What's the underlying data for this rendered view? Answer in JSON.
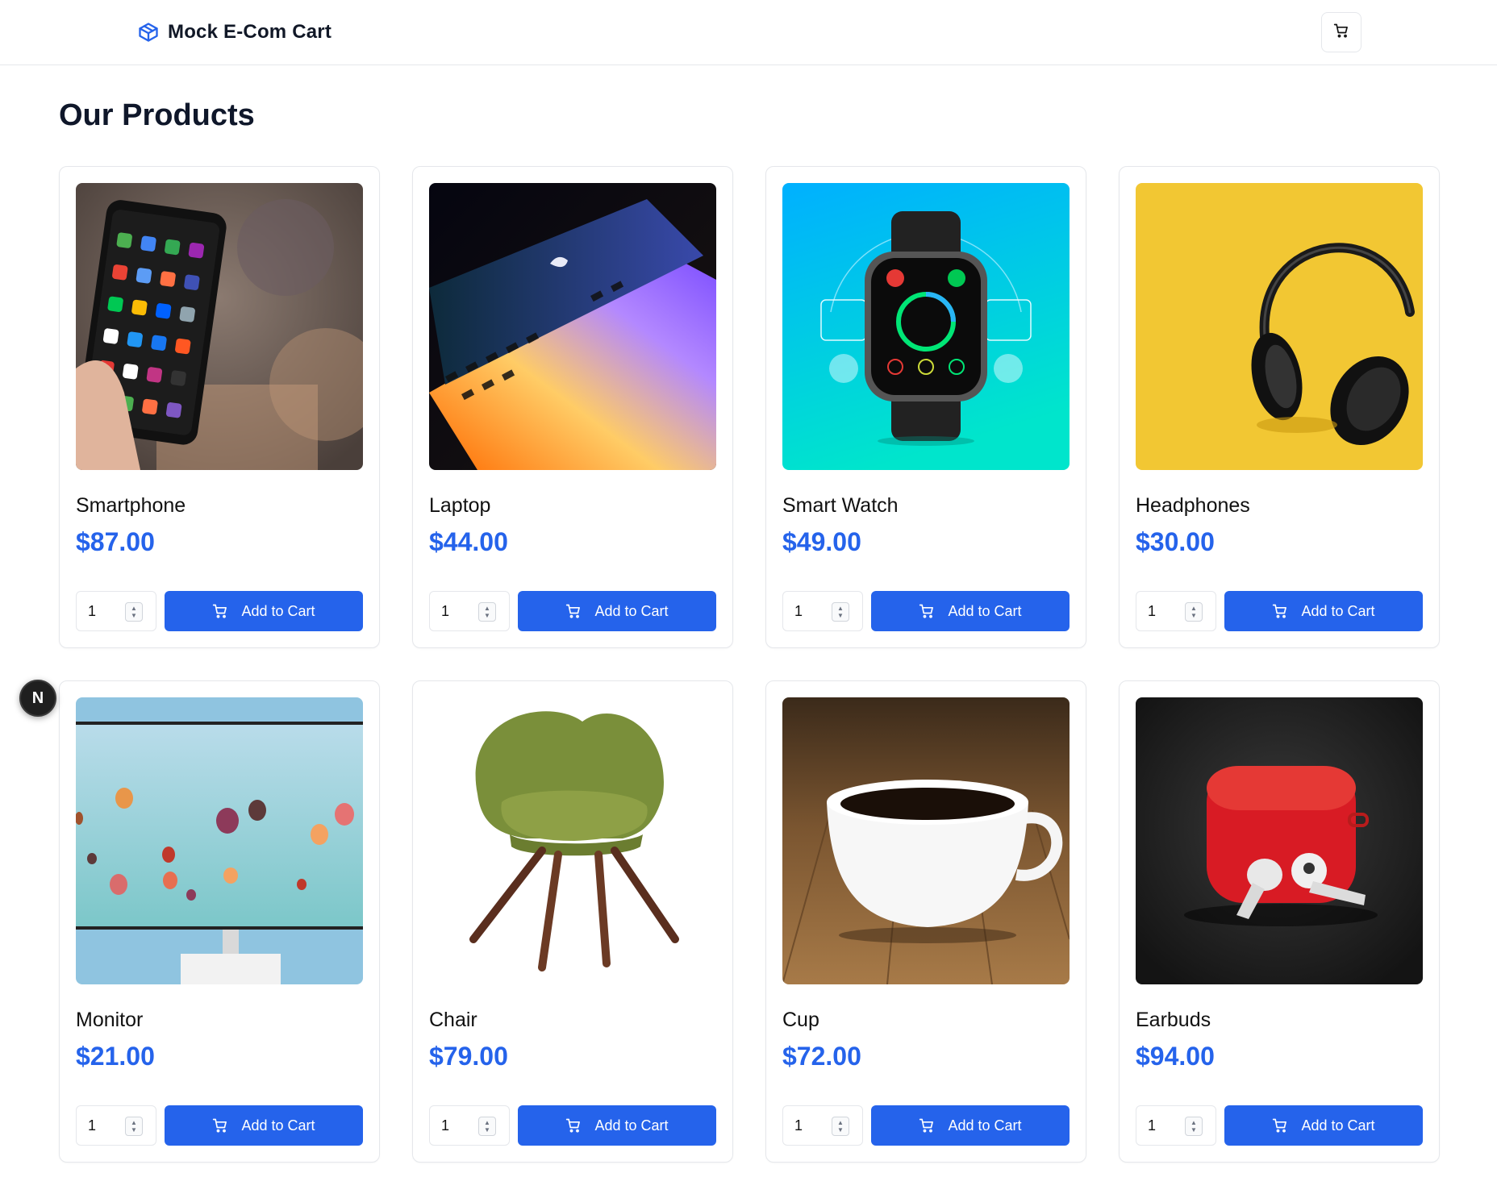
{
  "header": {
    "brand": "Mock E-Com Cart",
    "brand_icon": "package-icon",
    "cart_icon": "shopping-cart-icon"
  },
  "main": {
    "title": "Our Products"
  },
  "products": [
    {
      "name": "Smartphone",
      "price": "$87.00",
      "qty": "1",
      "button": "Add to Cart",
      "image": "smartphone-photo"
    },
    {
      "name": "Laptop",
      "price": "$44.00",
      "qty": "1",
      "button": "Add to Cart",
      "image": "laptop-photo"
    },
    {
      "name": "Smart Watch",
      "price": "$49.00",
      "qty": "1",
      "button": "Add to Cart",
      "image": "smartwatch-photo"
    },
    {
      "name": "Headphones",
      "price": "$30.00",
      "qty": "1",
      "button": "Add to Cart",
      "image": "headphones-photo"
    },
    {
      "name": "Monitor",
      "price": "$21.00",
      "qty": "1",
      "button": "Add to Cart",
      "image": "monitor-photo"
    },
    {
      "name": "Chair",
      "price": "$79.00",
      "qty": "1",
      "button": "Add to Cart",
      "image": "chair-photo"
    },
    {
      "name": "Cup",
      "price": "$72.00",
      "qty": "1",
      "button": "Add to Cart",
      "image": "cup-photo"
    },
    {
      "name": "Earbuds",
      "price": "$94.00",
      "qty": "1",
      "button": "Add to Cart",
      "image": "earbuds-photo"
    }
  ],
  "dev_badge": {
    "label": "N"
  },
  "colors": {
    "accent": "#2563eb",
    "border": "#e5e7eb",
    "text": "#111111"
  }
}
